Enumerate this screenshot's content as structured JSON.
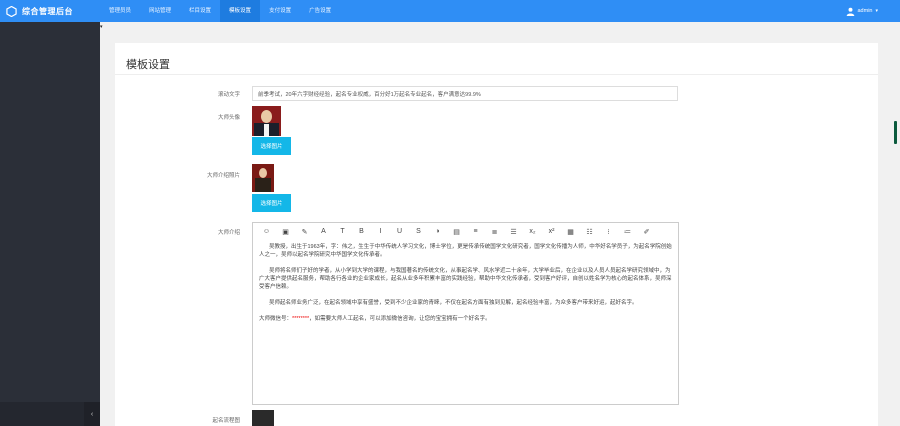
{
  "app": {
    "title": "综合管理后台"
  },
  "nav": {
    "items": [
      {
        "label": "管理员员"
      },
      {
        "label": "网站管理"
      },
      {
        "label": "栏目设置"
      },
      {
        "label": "模板设置",
        "active": true
      },
      {
        "label": "支付设置"
      },
      {
        "label": "广告设置"
      }
    ]
  },
  "user": {
    "name": "admin"
  },
  "page": {
    "title": "模板设置"
  },
  "form": {
    "scroll_text_label": "滚动文字",
    "scroll_text_value": "前季考试，20年六字财经经验，起名专业权威，百分好1万起名专业起名，客户满意达99.9%",
    "master_avatar_label": "大师头像",
    "master_photo_label": "大师介绍照片",
    "upload_label": "选择图片",
    "intro_label": "大师介绍",
    "name_photo_label": "起名流程图"
  },
  "toolbar": {
    "buttons": [
      "☺",
      "▣",
      "✎",
      "A",
      "T",
      "B",
      "I",
      "U",
      "S",
      "◑",
      "▤",
      "≡",
      "≣",
      "☰",
      "x₂",
      "x²",
      "▦",
      "☷",
      "⁝",
      "≔",
      "✐"
    ]
  },
  "intro": {
    "p1": "吴教授，出生于1963年，字：伟之，生生于中华传统人学习文化，博士学位，更是传承传统国学文化研究者，国学文化传播为人师，中华好名学员子，为起名学院创始人之一，吴师以起名学院研究中华国学文化传承者。",
    "p2": "吴师将名师们子好的学者，从小学到大学的课程，与我国著名的传统文化，从事起名学、风水学近二十余年，大学毕业后，在企业以及人员人员起名学研究领域中，为广大客户提供起名服务，帮助各行各业的企业家成长，起名从业多年积累丰富的实践经验，帮助中华文化传承者，受到客户好评，自创以姓名学为核心的起名体系，吴师深受客户信赖。",
    "p3": "吴师起名师业务广泛，在起名领域中享有盛誉，受到不少企业家的青睐，不仅在起名方面有独到见解，起名经验丰富，为众多客户带来好运，起好名字。",
    "p4_prefix": "大师微信号：",
    "p4_red": "********",
    "p4_suffix": "，如需要大师人工起名，可以添加微信咨询，让您的宝宝拥有一个好名字。"
  }
}
